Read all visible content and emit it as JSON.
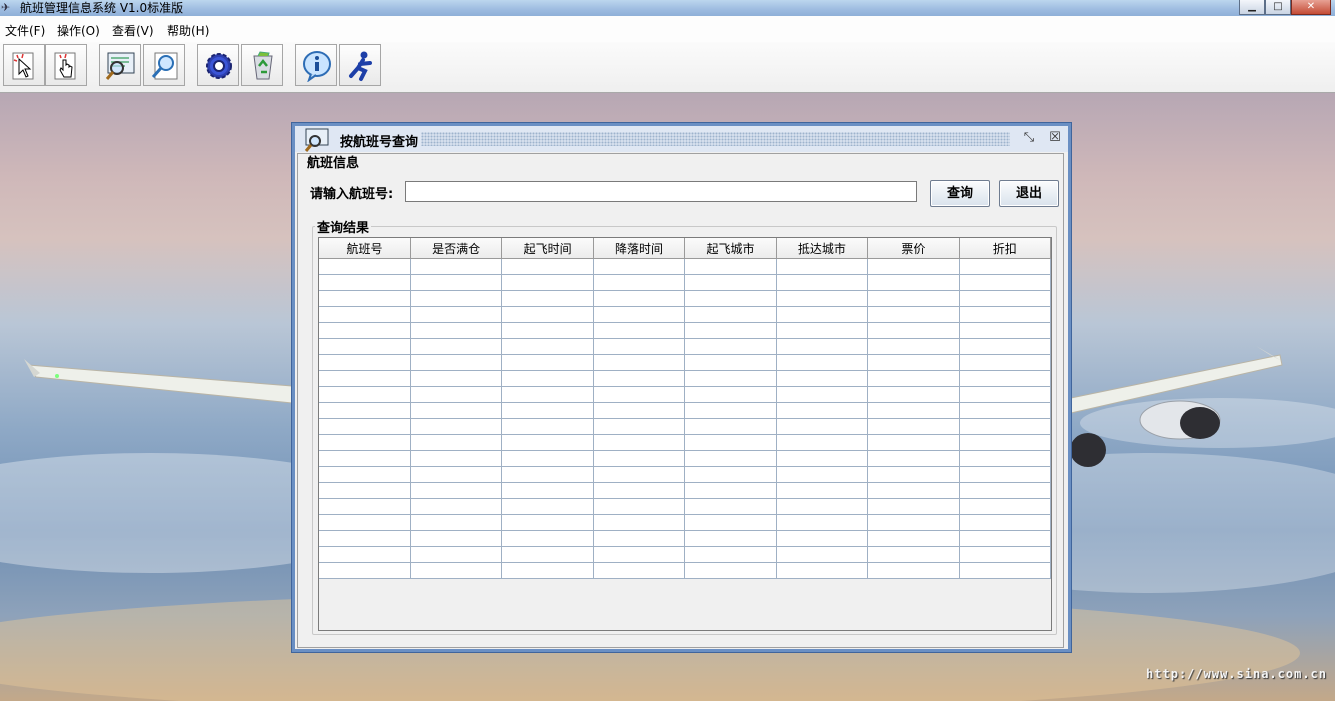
{
  "window": {
    "title": "航班管理信息系统 V1.0标准版"
  },
  "menu": {
    "items": [
      "文件(F)",
      "操作(O)",
      "查看(V)",
      "帮助(H)"
    ]
  },
  "toolbar": {
    "buttons": [
      {
        "name": "pointer-cursor-icon"
      },
      {
        "name": "hand-cursor-icon"
      },
      {
        "name": "search-screen-icon"
      },
      {
        "name": "magnifier-document-icon"
      },
      {
        "name": "gear-icon"
      },
      {
        "name": "recycle-bin-icon"
      },
      {
        "name": "info-icon"
      },
      {
        "name": "running-person-icon"
      }
    ]
  },
  "dialog": {
    "title": "按航班号查询",
    "group_info_label": "航班信息",
    "input_label": "请输入航班号:",
    "input_value": "",
    "query_button": "查询",
    "exit_button": "退出",
    "group_result_label": "查询结果",
    "table": {
      "columns": [
        "航班号",
        "是否满仓",
        "起飞时间",
        "降落时间",
        "起飞城市",
        "抵达城市",
        "票价",
        "折扣"
      ],
      "rows": []
    }
  },
  "background": {
    "watermark": "http://www.sina.com.cn"
  },
  "colors": {
    "frame_border": "#6a8fc3",
    "title_bar": "#9dbbe0"
  }
}
